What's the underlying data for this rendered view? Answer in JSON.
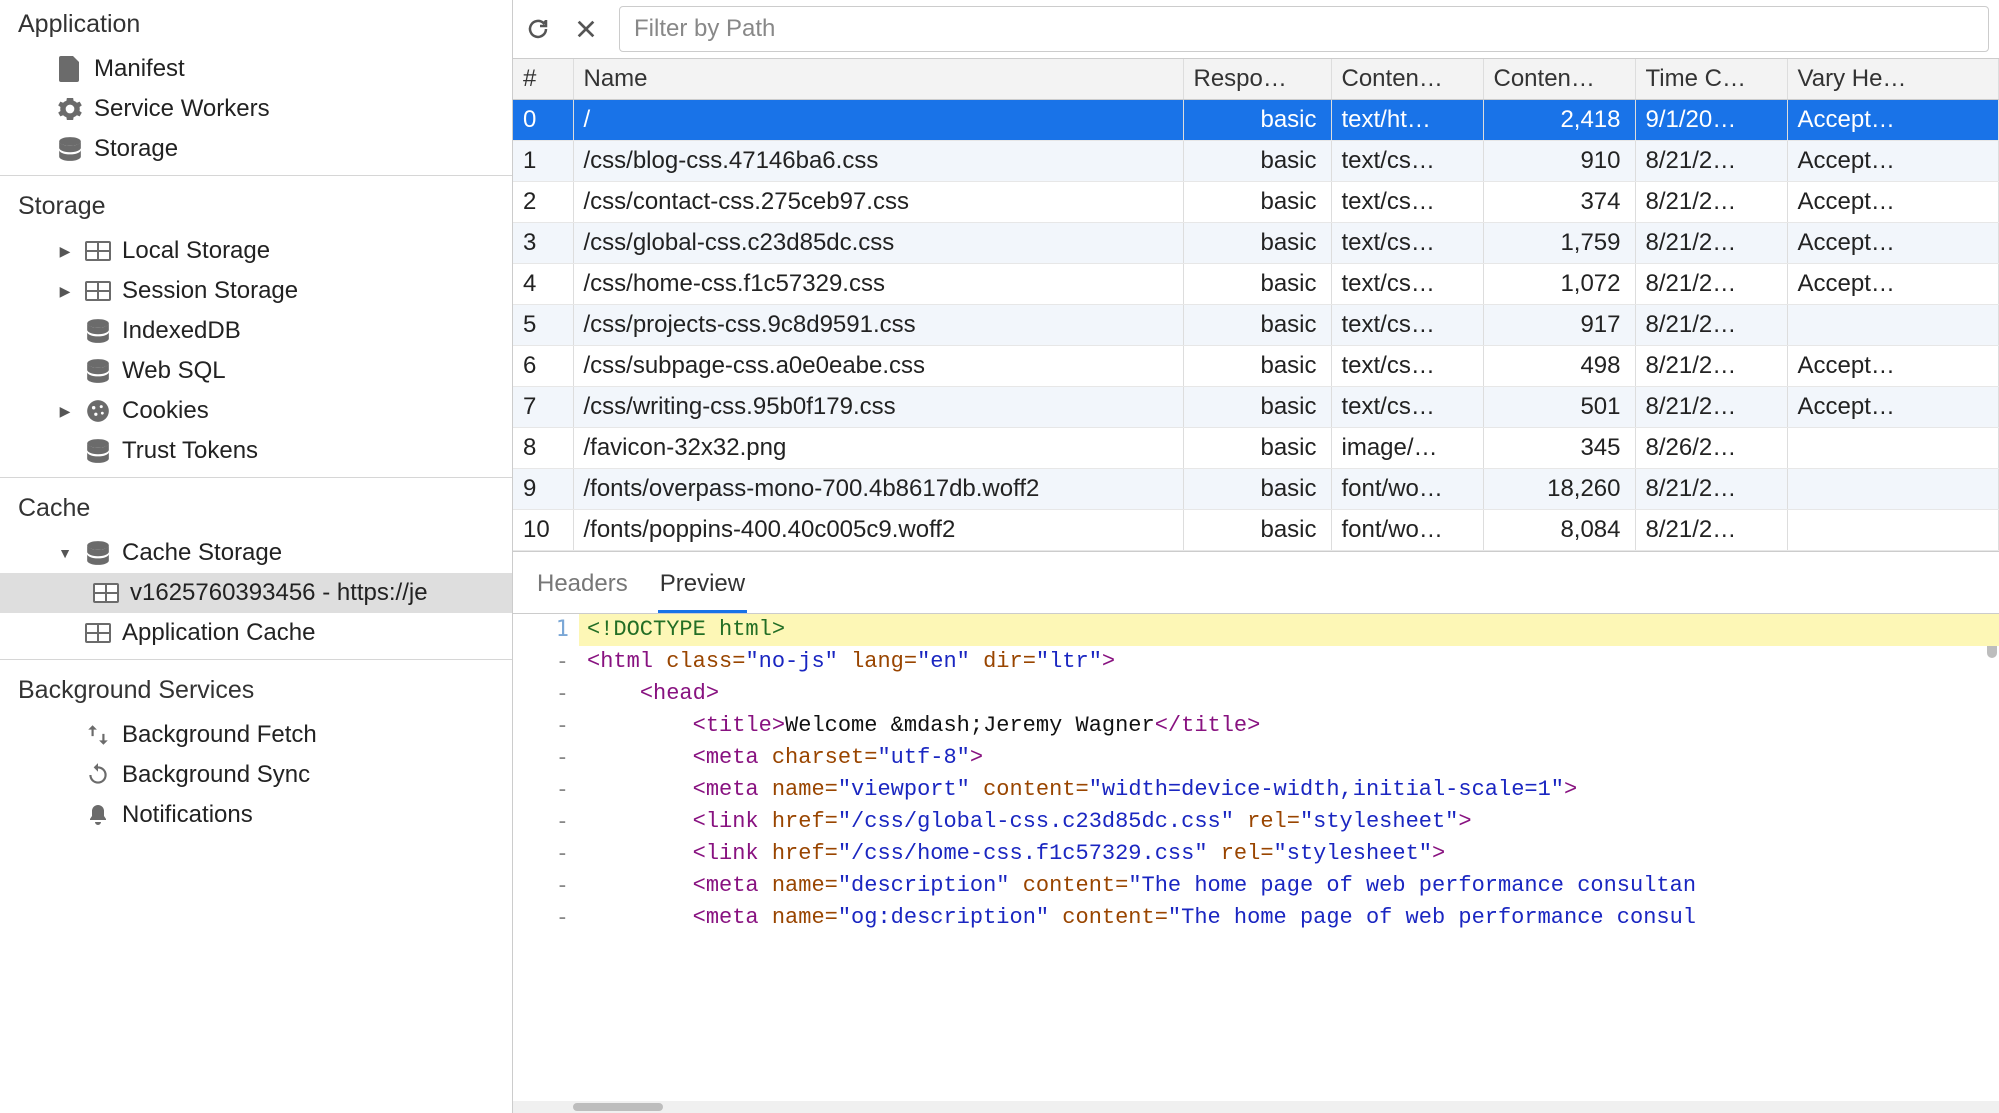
{
  "sidebar": {
    "sections": {
      "application": {
        "title": "Application",
        "items": [
          {
            "id": "manifest",
            "label": "Manifest",
            "icon": "file-icon"
          },
          {
            "id": "service-workers",
            "label": "Service Workers",
            "icon": "gear-icon"
          },
          {
            "id": "storage",
            "label": "Storage",
            "icon": "db-icon"
          }
        ]
      },
      "storage": {
        "title": "Storage",
        "items": [
          {
            "id": "local-storage",
            "label": "Local Storage",
            "icon": "table-icon",
            "expandable": true
          },
          {
            "id": "session-storage",
            "label": "Session Storage",
            "icon": "table-icon",
            "expandable": true
          },
          {
            "id": "indexeddb",
            "label": "IndexedDB",
            "icon": "db-icon"
          },
          {
            "id": "web-sql",
            "label": "Web SQL",
            "icon": "db-icon"
          },
          {
            "id": "cookies",
            "label": "Cookies",
            "icon": "cookie-icon",
            "expandable": true
          },
          {
            "id": "trust-tokens",
            "label": "Trust Tokens",
            "icon": "db-icon"
          }
        ]
      },
      "cache": {
        "title": "Cache",
        "items": [
          {
            "id": "cache-storage",
            "label": "Cache Storage",
            "icon": "db-icon",
            "expandable": true,
            "expanded": true,
            "children": [
              {
                "id": "cache-entry-0",
                "label": "v1625760393456 - https://je",
                "icon": "table-icon",
                "selected": true
              }
            ]
          },
          {
            "id": "application-cache",
            "label": "Application Cache",
            "icon": "table-icon"
          }
        ]
      },
      "background": {
        "title": "Background Services",
        "items": [
          {
            "id": "background-fetch",
            "label": "Background Fetch",
            "icon": "fetch-icon"
          },
          {
            "id": "background-sync",
            "label": "Background Sync",
            "icon": "sync-icon"
          },
          {
            "id": "notifications",
            "label": "Notifications",
            "icon": "bell-icon"
          }
        ]
      }
    }
  },
  "toolbar": {
    "filter_placeholder": "Filter by Path"
  },
  "table": {
    "columns": {
      "index": "#",
      "name": "Name",
      "response": "Respo…",
      "content_type": "Conten…",
      "content_length": "Conten…",
      "time_cached": "Time C…",
      "vary": "Vary He…"
    },
    "rows": [
      {
        "i": "0",
        "name": "/",
        "resp": "basic",
        "ctype": "text/ht…",
        "clen": "2,418",
        "time": "9/1/20…",
        "vary": "Accept…",
        "selected": true
      },
      {
        "i": "1",
        "name": "/css/blog-css.47146ba6.css",
        "resp": "basic",
        "ctype": "text/cs…",
        "clen": "910",
        "time": "8/21/2…",
        "vary": "Accept…"
      },
      {
        "i": "2",
        "name": "/css/contact-css.275ceb97.css",
        "resp": "basic",
        "ctype": "text/cs…",
        "clen": "374",
        "time": "8/21/2…",
        "vary": "Accept…"
      },
      {
        "i": "3",
        "name": "/css/global-css.c23d85dc.css",
        "resp": "basic",
        "ctype": "text/cs…",
        "clen": "1,759",
        "time": "8/21/2…",
        "vary": "Accept…"
      },
      {
        "i": "4",
        "name": "/css/home-css.f1c57329.css",
        "resp": "basic",
        "ctype": "text/cs…",
        "clen": "1,072",
        "time": "8/21/2…",
        "vary": "Accept…"
      },
      {
        "i": "5",
        "name": "/css/projects-css.9c8d9591.css",
        "resp": "basic",
        "ctype": "text/cs…",
        "clen": "917",
        "time": "8/21/2…",
        "vary": ""
      },
      {
        "i": "6",
        "name": "/css/subpage-css.a0e0eabe.css",
        "resp": "basic",
        "ctype": "text/cs…",
        "clen": "498",
        "time": "8/21/2…",
        "vary": "Accept…"
      },
      {
        "i": "7",
        "name": "/css/writing-css.95b0f179.css",
        "resp": "basic",
        "ctype": "text/cs…",
        "clen": "501",
        "time": "8/21/2…",
        "vary": "Accept…"
      },
      {
        "i": "8",
        "name": "/favicon-32x32.png",
        "resp": "basic",
        "ctype": "image/…",
        "clen": "345",
        "time": "8/26/2…",
        "vary": ""
      },
      {
        "i": "9",
        "name": "/fonts/overpass-mono-700.4b8617db.woff2",
        "resp": "basic",
        "ctype": "font/wo…",
        "clen": "18,260",
        "time": "8/21/2…",
        "vary": ""
      },
      {
        "i": "10",
        "name": "/fonts/poppins-400.40c005c9.woff2",
        "resp": "basic",
        "ctype": "font/wo…",
        "clen": "8,084",
        "time": "8/21/2…",
        "vary": ""
      }
    ]
  },
  "details": {
    "tabs": {
      "headers": "Headers",
      "preview": "Preview",
      "active": "preview"
    },
    "code": {
      "lines": [
        {
          "n": "1",
          "indent": 0,
          "hl": true,
          "tokens": [
            {
              "t": "doctype",
              "v": "<!DOCTYPE html>"
            }
          ]
        },
        {
          "n": "-",
          "indent": 0,
          "tokens": [
            {
              "t": "tag-open",
              "v": "<html "
            },
            {
              "t": "attr-name",
              "v": "class="
            },
            {
              "t": "attr-val",
              "v": "\"no-js\""
            },
            {
              "t": "plain",
              "v": " "
            },
            {
              "t": "attr-name",
              "v": "lang="
            },
            {
              "t": "attr-val",
              "v": "\"en\""
            },
            {
              "t": "plain",
              "v": " "
            },
            {
              "t": "attr-name",
              "v": "dir="
            },
            {
              "t": "attr-val",
              "v": "\"ltr\""
            },
            {
              "t": "tag-open",
              "v": ">"
            }
          ]
        },
        {
          "n": "-",
          "indent": 1,
          "tokens": [
            {
              "t": "tag-open",
              "v": "<head>"
            }
          ]
        },
        {
          "n": "-",
          "indent": 2,
          "tokens": [
            {
              "t": "tag-open",
              "v": "<title>"
            },
            {
              "t": "plain",
              "v": "Welcome &mdash;Jeremy Wagner"
            },
            {
              "t": "tag-close",
              "v": "</title>"
            }
          ]
        },
        {
          "n": "-",
          "indent": 2,
          "tokens": [
            {
              "t": "tag-open",
              "v": "<meta "
            },
            {
              "t": "attr-name",
              "v": "charset="
            },
            {
              "t": "attr-val",
              "v": "\"utf-8\""
            },
            {
              "t": "tag-open",
              "v": ">"
            }
          ]
        },
        {
          "n": "-",
          "indent": 2,
          "tokens": [
            {
              "t": "tag-open",
              "v": "<meta "
            },
            {
              "t": "attr-name",
              "v": "name="
            },
            {
              "t": "attr-val",
              "v": "\"viewport\""
            },
            {
              "t": "plain",
              "v": " "
            },
            {
              "t": "attr-name",
              "v": "content="
            },
            {
              "t": "attr-val",
              "v": "\"width=device-width,initial-scale=1\""
            },
            {
              "t": "tag-open",
              "v": ">"
            }
          ]
        },
        {
          "n": "-",
          "indent": 2,
          "tokens": [
            {
              "t": "tag-open",
              "v": "<link "
            },
            {
              "t": "attr-name",
              "v": "href="
            },
            {
              "t": "attr-val",
              "v": "\"/css/global-css.c23d85dc.css\""
            },
            {
              "t": "plain",
              "v": " "
            },
            {
              "t": "attr-name",
              "v": "rel="
            },
            {
              "t": "attr-val",
              "v": "\"stylesheet\""
            },
            {
              "t": "tag-open",
              "v": ">"
            }
          ]
        },
        {
          "n": "-",
          "indent": 2,
          "tokens": [
            {
              "t": "tag-open",
              "v": "<link "
            },
            {
              "t": "attr-name",
              "v": "href="
            },
            {
              "t": "attr-val",
              "v": "\"/css/home-css.f1c57329.css\""
            },
            {
              "t": "plain",
              "v": " "
            },
            {
              "t": "attr-name",
              "v": "rel="
            },
            {
              "t": "attr-val",
              "v": "\"stylesheet\""
            },
            {
              "t": "tag-open",
              "v": ">"
            }
          ]
        },
        {
          "n": "-",
          "indent": 2,
          "tokens": [
            {
              "t": "tag-open",
              "v": "<meta "
            },
            {
              "t": "attr-name",
              "v": "name="
            },
            {
              "t": "attr-val",
              "v": "\"description\""
            },
            {
              "t": "plain",
              "v": " "
            },
            {
              "t": "attr-name",
              "v": "content="
            },
            {
              "t": "attr-val",
              "v": "\"The home page of web performance consultan"
            }
          ]
        },
        {
          "n": "-",
          "indent": 2,
          "tokens": [
            {
              "t": "tag-open",
              "v": "<meta "
            },
            {
              "t": "attr-name",
              "v": "name="
            },
            {
              "t": "attr-val",
              "v": "\"og:description\""
            },
            {
              "t": "plain",
              "v": " "
            },
            {
              "t": "attr-name",
              "v": "content="
            },
            {
              "t": "attr-val",
              "v": "\"The home page of web performance consul"
            }
          ]
        }
      ]
    }
  }
}
